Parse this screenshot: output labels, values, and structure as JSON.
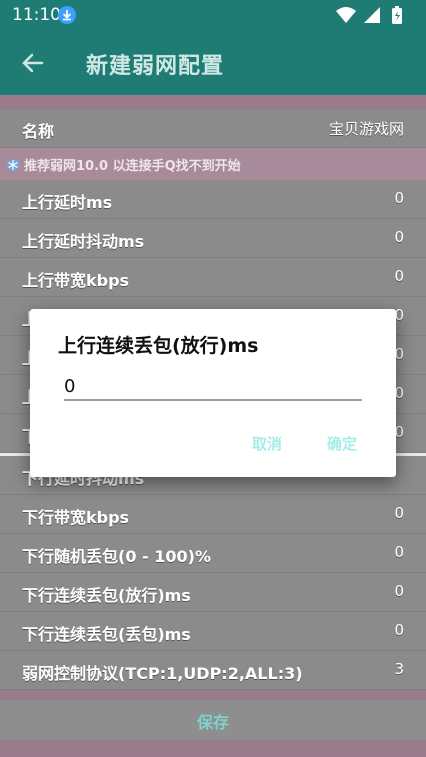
{
  "status": {
    "time": "11:10"
  },
  "appbar": {
    "title": "新建弱网配置"
  },
  "name_row": {
    "label": "名称",
    "value": "宝贝游戏网"
  },
  "notice": "推荐弱网10.0 以连接手Q找不到开始",
  "rows": [
    {
      "label": "上行延时ms",
      "value": "0"
    },
    {
      "label": "上行延时抖动ms",
      "value": "0"
    },
    {
      "label": "上行带宽kbps",
      "value": "0"
    },
    {
      "label": "上",
      "value": "0"
    },
    {
      "label": "上",
      "value": "0"
    },
    {
      "label": "上",
      "value": "0"
    },
    {
      "label": "下",
      "value": "0"
    },
    {
      "label": "下行延时抖动ms",
      "value": ""
    },
    {
      "label": "下行带宽kbps",
      "value": "0"
    },
    {
      "label": "下行随机丢包(0 - 100)%",
      "value": "0"
    },
    {
      "label": "下行连续丢包(放行)ms",
      "value": "0"
    },
    {
      "label": "下行连续丢包(丢包)ms",
      "value": "0"
    },
    {
      "label": "弱网控制协议(TCP:1,UDP:2,ALL:3)",
      "value": "3"
    }
  ],
  "save_label": "保存",
  "dialog": {
    "title": "上行连续丢包(放行)ms",
    "input_value": "0",
    "cancel_label": "取消",
    "ok_label": "确定"
  },
  "colors": {
    "teal": "#1f7c74",
    "accent": "#a7ede7",
    "pink_band": "#a78b9a"
  }
}
